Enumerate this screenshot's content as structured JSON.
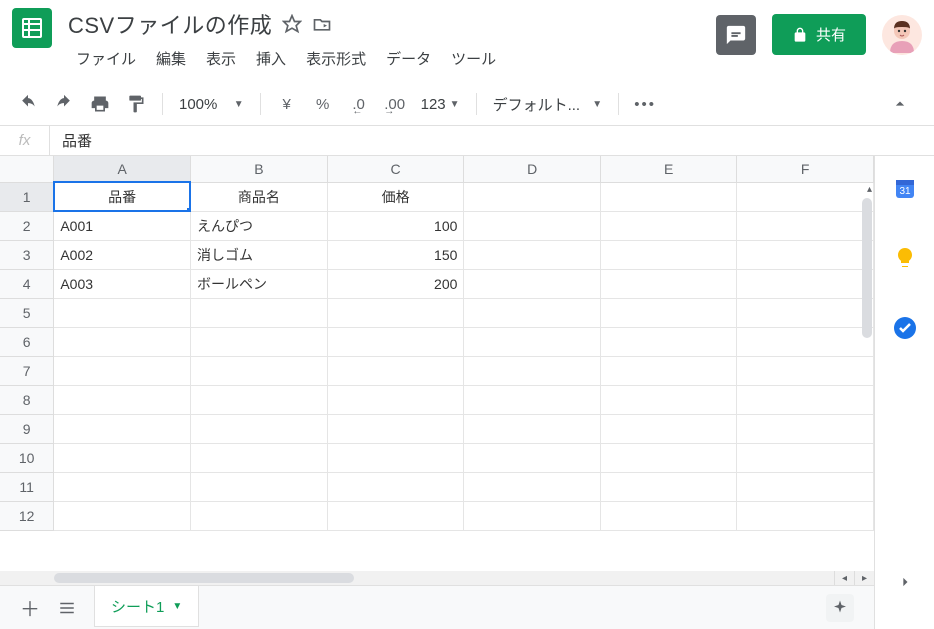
{
  "doc_title": "CSVファイルの作成",
  "menus": [
    "ファイル",
    "編集",
    "表示",
    "挿入",
    "表示形式",
    "データ",
    "ツール"
  ],
  "share_label": "共有",
  "toolbar": {
    "zoom": "100%",
    "currency": "¥",
    "percent": "%",
    "dec_dec": ".0",
    "dec_inc": ".00",
    "num_format": "123",
    "font": "デフォルト..."
  },
  "formula_value": "品番",
  "columns": [
    "A",
    "B",
    "C",
    "D",
    "E",
    "F"
  ],
  "row_numbers": [
    1,
    2,
    3,
    4,
    5,
    6,
    7,
    8,
    9,
    10,
    11,
    12
  ],
  "active_cell": {
    "row": 1,
    "col": 0
  },
  "cells": [
    [
      {
        "v": "品番",
        "a": "center"
      },
      {
        "v": "商品名",
        "a": "center"
      },
      {
        "v": "価格",
        "a": "center"
      },
      {
        "v": ""
      },
      {
        "v": ""
      },
      {
        "v": ""
      }
    ],
    [
      {
        "v": "A001"
      },
      {
        "v": "えんぴつ"
      },
      {
        "v": "100",
        "a": "right"
      },
      {
        "v": ""
      },
      {
        "v": ""
      },
      {
        "v": ""
      }
    ],
    [
      {
        "v": "A002"
      },
      {
        "v": "消しゴム"
      },
      {
        "v": "150",
        "a": "right"
      },
      {
        "v": ""
      },
      {
        "v": ""
      },
      {
        "v": ""
      }
    ],
    [
      {
        "v": "A003"
      },
      {
        "v": "ボールペン"
      },
      {
        "v": "200",
        "a": "right"
      },
      {
        "v": ""
      },
      {
        "v": ""
      },
      {
        "v": ""
      }
    ],
    [
      {
        "v": ""
      },
      {
        "v": ""
      },
      {
        "v": ""
      },
      {
        "v": ""
      },
      {
        "v": ""
      },
      {
        "v": ""
      }
    ],
    [
      {
        "v": ""
      },
      {
        "v": ""
      },
      {
        "v": ""
      },
      {
        "v": ""
      },
      {
        "v": ""
      },
      {
        "v": ""
      }
    ],
    [
      {
        "v": ""
      },
      {
        "v": ""
      },
      {
        "v": ""
      },
      {
        "v": ""
      },
      {
        "v": ""
      },
      {
        "v": ""
      }
    ],
    [
      {
        "v": ""
      },
      {
        "v": ""
      },
      {
        "v": ""
      },
      {
        "v": ""
      },
      {
        "v": ""
      },
      {
        "v": ""
      }
    ],
    [
      {
        "v": ""
      },
      {
        "v": ""
      },
      {
        "v": ""
      },
      {
        "v": ""
      },
      {
        "v": ""
      },
      {
        "v": ""
      }
    ],
    [
      {
        "v": ""
      },
      {
        "v": ""
      },
      {
        "v": ""
      },
      {
        "v": ""
      },
      {
        "v": ""
      },
      {
        "v": ""
      }
    ],
    [
      {
        "v": ""
      },
      {
        "v": ""
      },
      {
        "v": ""
      },
      {
        "v": ""
      },
      {
        "v": ""
      },
      {
        "v": ""
      }
    ],
    [
      {
        "v": ""
      },
      {
        "v": ""
      },
      {
        "v": ""
      },
      {
        "v": ""
      },
      {
        "v": ""
      },
      {
        "v": ""
      }
    ]
  ],
  "sheet_tab": "シート1",
  "chart_data": {
    "type": "table",
    "columns": [
      "品番",
      "商品名",
      "価格"
    ],
    "rows": [
      [
        "A001",
        "えんぴつ",
        100
      ],
      [
        "A002",
        "消しゴム",
        150
      ],
      [
        "A003",
        "ボールペン",
        200
      ]
    ]
  }
}
